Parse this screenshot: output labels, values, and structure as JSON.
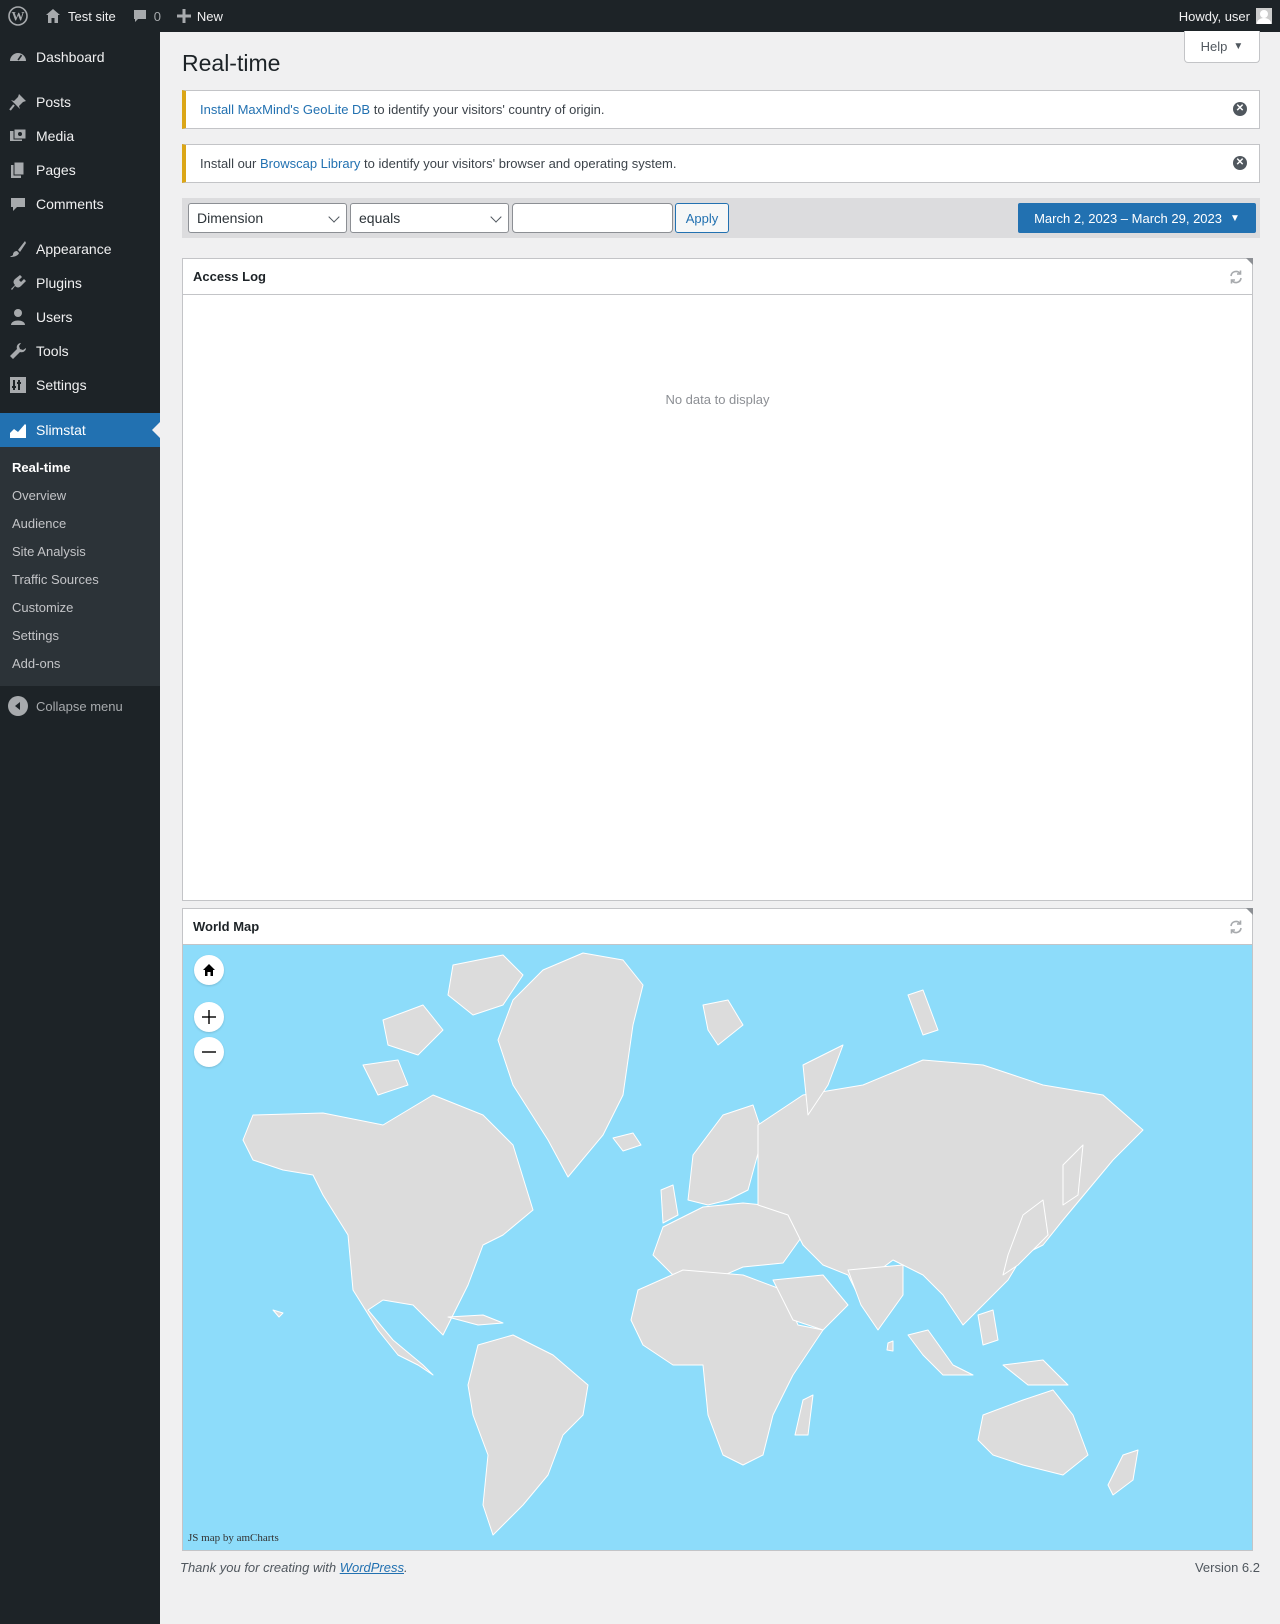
{
  "adminbar": {
    "site_name": "Test site",
    "comments_count": "0",
    "new_label": "New",
    "greeting": "Howdy, user"
  },
  "sidebar": {
    "items": [
      {
        "label": "Dashboard",
        "icon": "dashboard-icon"
      },
      {
        "label": "Posts",
        "icon": "pin-icon"
      },
      {
        "label": "Media",
        "icon": "media-icon"
      },
      {
        "label": "Pages",
        "icon": "pages-icon"
      },
      {
        "label": "Comments",
        "icon": "comment-icon"
      },
      {
        "label": "Appearance",
        "icon": "brush-icon"
      },
      {
        "label": "Plugins",
        "icon": "plug-icon"
      },
      {
        "label": "Users",
        "icon": "user-icon"
      },
      {
        "label": "Tools",
        "icon": "wrench-icon"
      },
      {
        "label": "Settings",
        "icon": "settings-icon"
      },
      {
        "label": "Slimstat",
        "icon": "chart-icon"
      }
    ],
    "submenu": [
      "Real-time",
      "Overview",
      "Audience",
      "Site Analysis",
      "Traffic Sources",
      "Customize",
      "Settings",
      "Add-ons"
    ],
    "collapse_label": "Collapse menu"
  },
  "help_label": "Help",
  "page_title": "Real-time",
  "notices": [
    {
      "link": "Install MaxMind's GeoLite DB",
      "prefix": "",
      "suffix": " to identify your visitors' country of origin."
    },
    {
      "link": "Browscap Library",
      "prefix": "Install our ",
      "suffix": " to identify your visitors' browser and operating system."
    }
  ],
  "filter": {
    "dimension": "Dimension",
    "operator": "equals",
    "value": "",
    "apply_label": "Apply",
    "date_range": "March 2, 2023 – March 29, 2023"
  },
  "access_log": {
    "title": "Access Log",
    "empty": "No data to display"
  },
  "world_map": {
    "title": "World Map",
    "credit": "JS map by amCharts"
  },
  "footer": {
    "text": "Thank you for creating with ",
    "link": "WordPress",
    "end": ".",
    "version": "Version 6.2"
  },
  "colors": {
    "accent": "#2271b1",
    "sidebar_bg": "#1d2327",
    "map_water": "#8ddcfa",
    "map_land": "#dcdcdc",
    "notice_warning": "#dba617"
  }
}
